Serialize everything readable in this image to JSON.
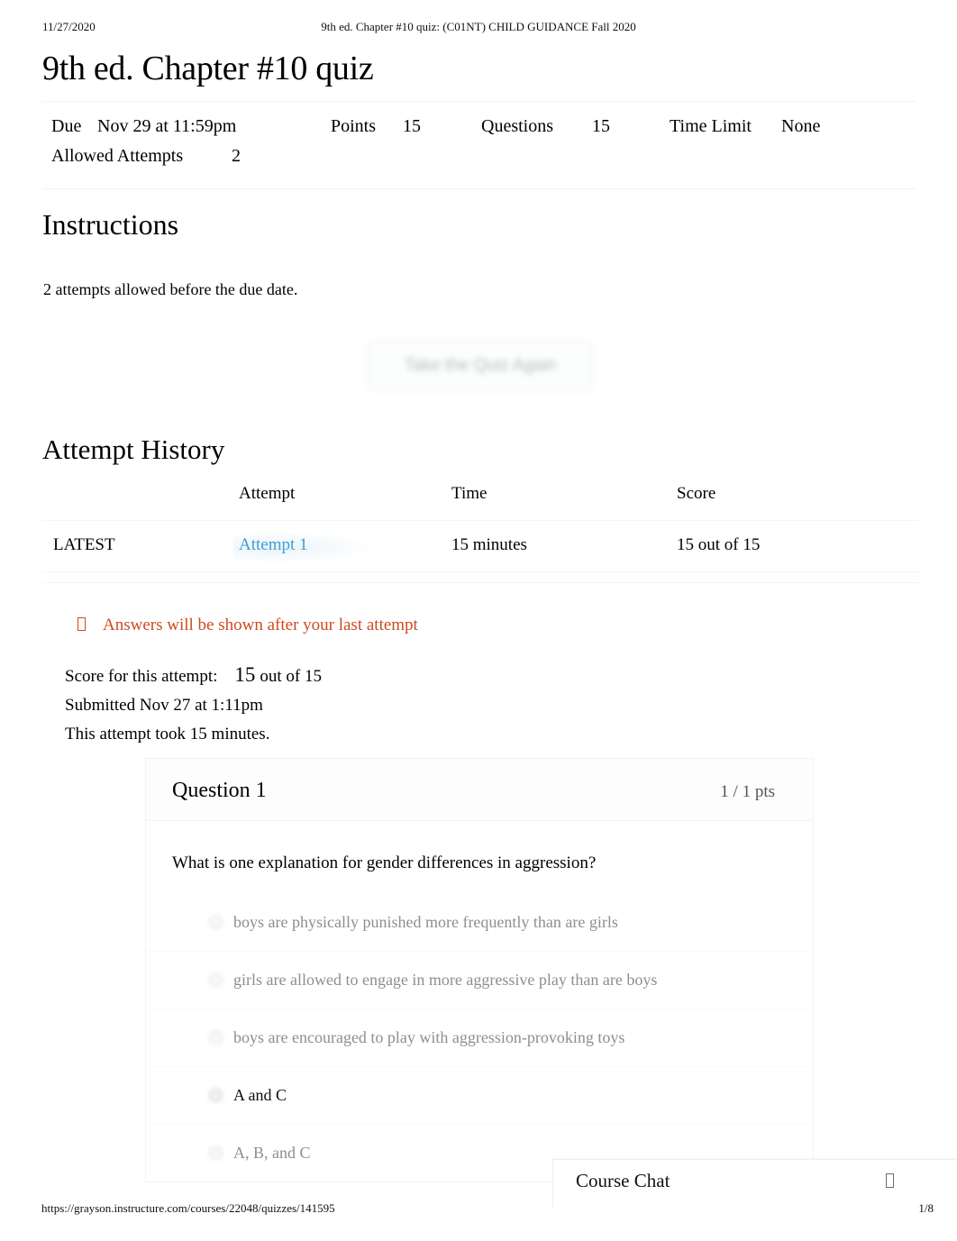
{
  "print_header": {
    "date": "11/27/2020",
    "document_title": "9th ed. Chapter #10 quiz: (C01NT) CHILD GUIDANCE Fall 2020"
  },
  "quiz": {
    "title": "9th ed. Chapter #10 quiz",
    "details": {
      "due_label": "Due",
      "due_value": "Nov 29 at 11:59pm",
      "points_label": "Points",
      "points_value": "15",
      "questions_label": "Questions",
      "questions_value": "15",
      "time_limit_label": "Time Limit",
      "time_limit_value": "None",
      "allowed_attempts_label": "Allowed Attempts",
      "allowed_attempts_value": "2"
    }
  },
  "instructions": {
    "heading": "Instructions",
    "body": "2 attempts allowed before the due date."
  },
  "actions": {
    "take_quiz_again": "Take the Quiz Again"
  },
  "attempt_history": {
    "heading": "Attempt History",
    "columns": [
      "",
      "Attempt",
      "Time",
      "Score"
    ],
    "rows": [
      {
        "kept": "LATEST",
        "attempt": "Attempt 1",
        "time": "15 minutes",
        "score": "15 out of 15"
      }
    ]
  },
  "notice": {
    "icon": "warning-icon",
    "text": "Answers will be shown after your last attempt"
  },
  "attempt_summary": {
    "score_label": "Score for this attempt:",
    "score_value": "15",
    "score_out_of": "out of 15",
    "submitted": "Submitted Nov 27 at 1:11pm",
    "duration": "This attempt took 15 minutes."
  },
  "question": {
    "number_label": "Question 1",
    "points_label": "1 / 1 pts",
    "text": "What is one explanation for gender differences in aggression?",
    "answers": [
      {
        "label": "boys are physically punished more frequently than are girls",
        "selected": false
      },
      {
        "label": "girls are allowed to engage in more aggressive play than are boys",
        "selected": false
      },
      {
        "label": "boys are encouraged to play with aggression-provoking toys",
        "selected": false
      },
      {
        "label": "A and C",
        "selected": true
      },
      {
        "label": "A, B, and C",
        "selected": false
      }
    ]
  },
  "course_chat": {
    "title": "Course Chat",
    "icon": "expand-icon"
  },
  "print_footer": {
    "url": "https://grayson.instructure.com/courses/22048/quizzes/141595",
    "page": "1/8"
  },
  "colors": {
    "link": "#1f8ed0",
    "notice": "#cc4b1f",
    "text": "#000000",
    "muted": "#8a8f93"
  }
}
